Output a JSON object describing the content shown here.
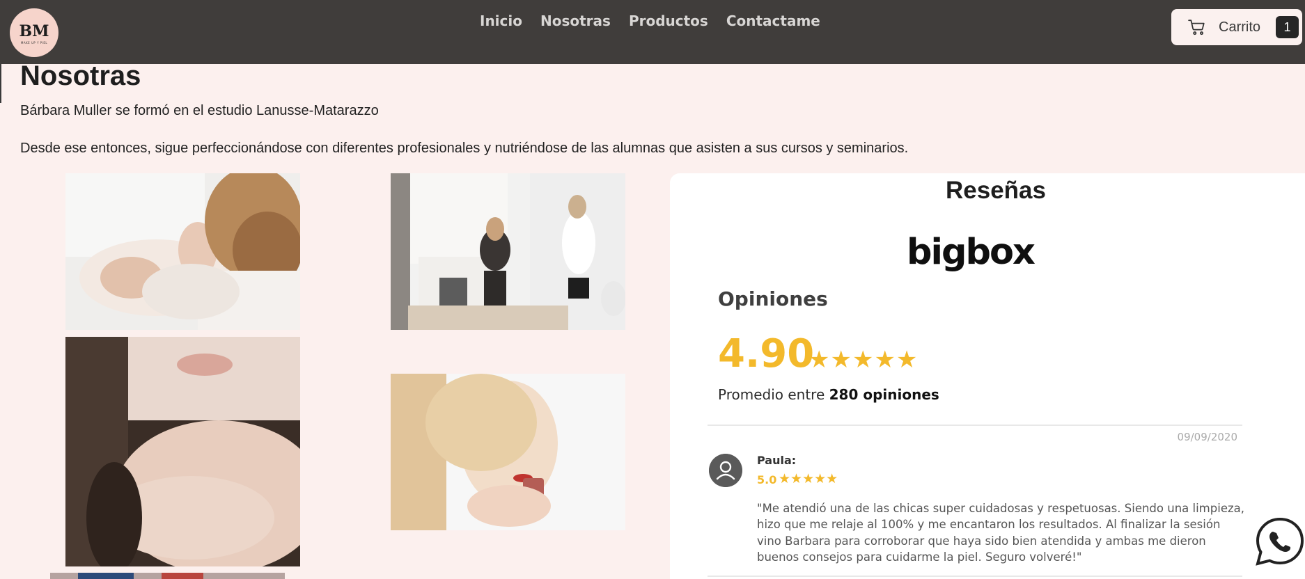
{
  "navbar": {
    "logo_text": "BM",
    "logo_subtext": "MAKE UP Y PIEL",
    "links": [
      "Inicio",
      "Nosotras",
      "Productos",
      "Contactame"
    ],
    "cart_label": "Carrito",
    "cart_count": "1",
    "cart_icon": "cart-icon"
  },
  "about": {
    "title": "Nosotras",
    "paragraph_1": "Bárbara Muller se formó en el estudio Lanusse-Matarazzo",
    "paragraph_2": "Desde ese entonces, sigue perfeccionándose con diferentes profesionales y nutriéndose de las alumnas que asisten a sus cursos y seminarios."
  },
  "reviews": {
    "title": "Reseñas",
    "brand": "bigbox",
    "heading": "Opiniones",
    "rating": "4.90",
    "stars": "★★★★★",
    "average_prefix": "Promedio entre ",
    "average_count": "280 opiniones",
    "review": {
      "date": "09/09/2020",
      "name": "Paula:",
      "score": "5.0",
      "stars": "★★★★★",
      "text": "\"Me atendió una de las chicas super cuidadosas y respetuosas. Siendo una limpieza, hizo que me relaje al 100% y me encantaron los resultados. Al finalizar la sesión vino Barbara para corroborar que haya sido bien atendida y ambas me dieron buenos consejos para cuidarme la piel. Seguro volveré!\""
    },
    "star_color": "#f3b92b"
  },
  "colors": {
    "navbar_bg": "#403d3b",
    "page_bg": "#fcf0ee",
    "accent": "#f3b92b"
  }
}
